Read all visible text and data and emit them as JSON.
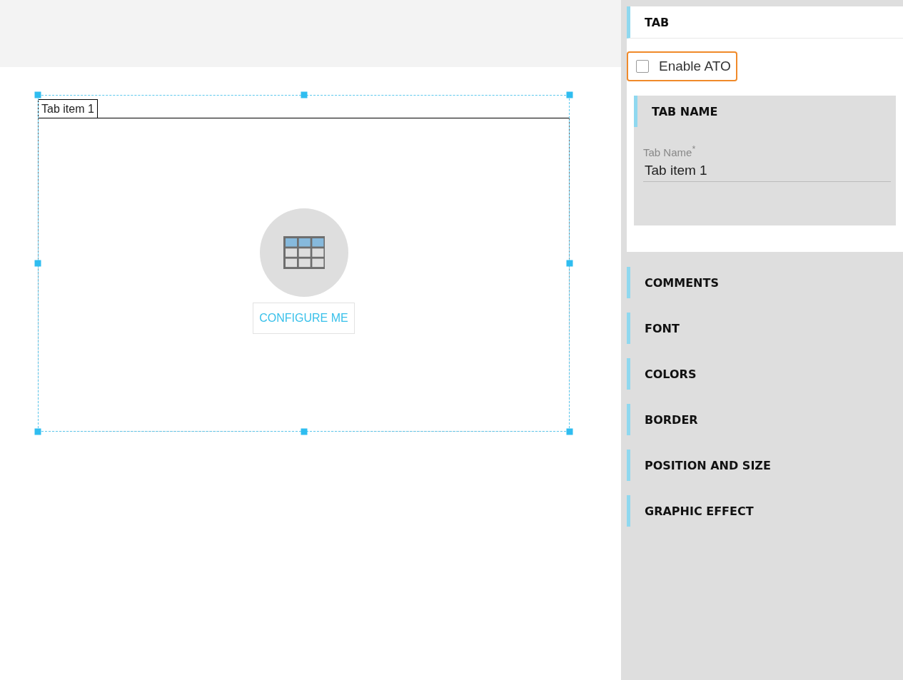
{
  "canvas": {
    "widget": {
      "selected": true,
      "tabs": [
        {
          "label": "Tab item 1"
        }
      ],
      "configure_button": "CONFIGURE ME"
    }
  },
  "panel": {
    "title": "TAB",
    "enable_ato": {
      "label": "Enable ATO",
      "checked": false
    },
    "tab_name": {
      "title": "TAB NAME",
      "field": {
        "label": "Tab Name",
        "required_mark": "*",
        "value": "Tab item 1"
      }
    },
    "sections": [
      "COMMENTS",
      "FONT",
      "COLORS",
      "BORDER",
      "POSITION AND SIZE",
      "GRAPHIC EFFECT"
    ]
  }
}
